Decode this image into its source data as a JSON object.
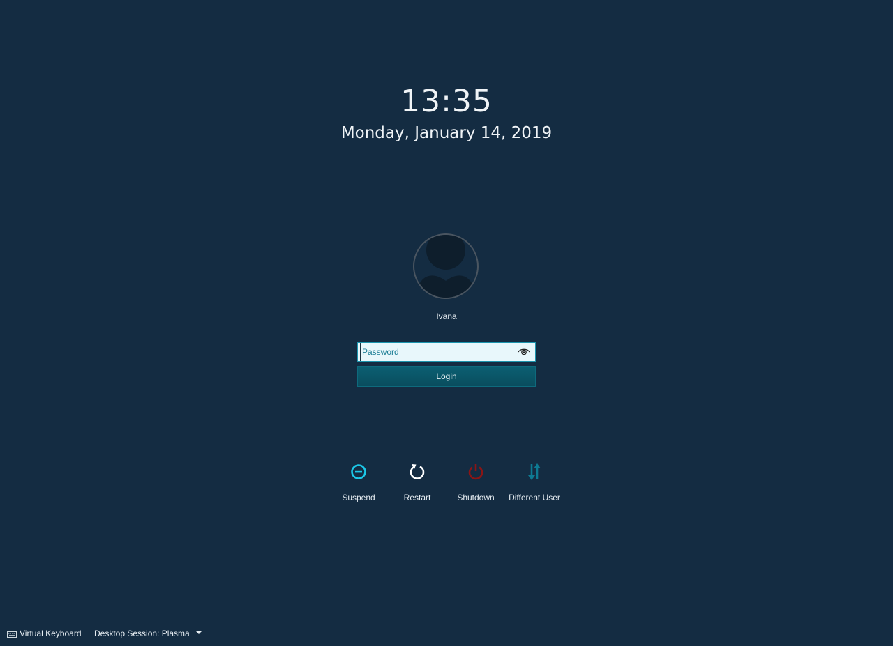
{
  "clock": {
    "time": "13:35",
    "date": "Monday, January 14, 2019"
  },
  "user": {
    "name": "Ivana"
  },
  "login": {
    "password_placeholder": "Password",
    "password_value": "",
    "login_label": "Login"
  },
  "actions": [
    {
      "label": "Suspend",
      "icon": "suspend-icon",
      "color": "#1cc8e8"
    },
    {
      "label": "Restart",
      "icon": "restart-icon",
      "color": "#ffffff"
    },
    {
      "label": "Shutdown",
      "icon": "shutdown-icon",
      "color": "#8b1515"
    },
    {
      "label": "Different User",
      "icon": "switch-user-icon",
      "color": "#0e7a93"
    }
  ],
  "footer": {
    "virtual_keyboard_label": "Virtual Keyboard",
    "session_label": "Desktop Session: Plasma"
  },
  "colors": {
    "background": "#142c42",
    "accent": "#1c95ae",
    "login_button": "#0b5f72"
  }
}
